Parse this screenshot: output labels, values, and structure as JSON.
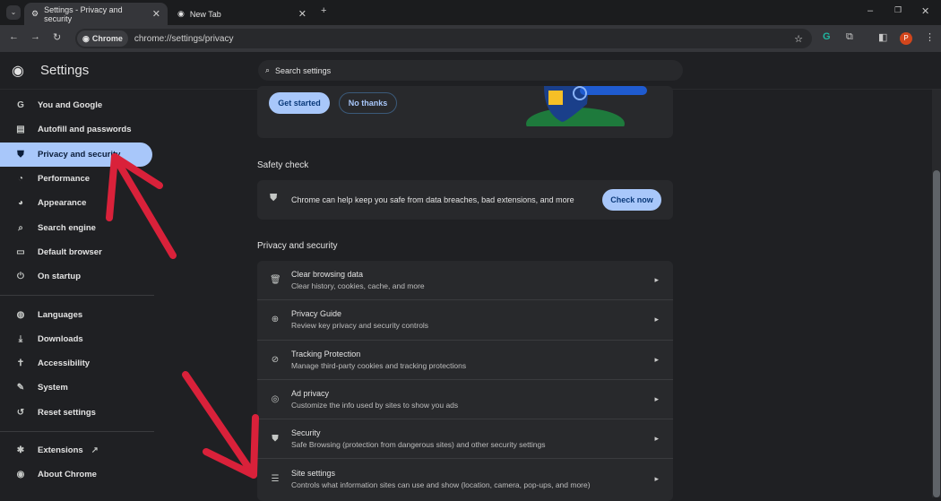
{
  "tabs": [
    {
      "label": "Settings - Privacy and security",
      "icon": "gear-icon"
    },
    {
      "label": "New Tab",
      "icon": "chrome-icon"
    }
  ],
  "omnibox": {
    "chip": "Chrome",
    "url": "chrome://settings/privacy"
  },
  "header": {
    "title": "Settings",
    "search_placeholder": "Search settings"
  },
  "profile_initial": "P",
  "sidebar": {
    "items": [
      {
        "label": "You and Google",
        "icon": "G"
      },
      {
        "label": "Autofill and passwords",
        "icon": "▤"
      },
      {
        "label": "Privacy and security",
        "icon": "⛊",
        "selected": true
      },
      {
        "label": "Performance",
        "icon": "◔"
      },
      {
        "label": "Appearance",
        "icon": "◕"
      },
      {
        "label": "Search engine",
        "icon": "⌕"
      },
      {
        "label": "Default browser",
        "icon": "▭"
      },
      {
        "label": "On startup",
        "icon": "⏻"
      },
      {
        "label": "Languages",
        "icon": "◍"
      },
      {
        "label": "Downloads",
        "icon": "⤓"
      },
      {
        "label": "Accessibility",
        "icon": "✝"
      },
      {
        "label": "System",
        "icon": "✎"
      },
      {
        "label": "Reset settings",
        "icon": "↺"
      },
      {
        "label": "Extensions",
        "icon": "✱"
      },
      {
        "label": "About Chrome",
        "icon": "◉"
      }
    ]
  },
  "promo": {
    "get_started": "Get started",
    "no_thanks": "No thanks"
  },
  "safety_check": {
    "heading": "Safety check",
    "text": "Chrome can help keep you safe from data breaches, bad extensions, and more",
    "button": "Check now"
  },
  "privacy": {
    "heading": "Privacy and security",
    "rows": [
      {
        "title": "Clear browsing data",
        "subtitle": "Clear history, cookies, cache, and more",
        "icon": "🗑"
      },
      {
        "title": "Privacy Guide",
        "subtitle": "Review key privacy and security controls",
        "icon": "⊕"
      },
      {
        "title": "Tracking Protection",
        "subtitle": "Manage third-party cookies and tracking protections",
        "icon": "⊘"
      },
      {
        "title": "Ad privacy",
        "subtitle": "Customize the info used by sites to show you ads",
        "icon": "◎"
      },
      {
        "title": "Security",
        "subtitle": "Safe Browsing (protection from dangerous sites) and other security settings",
        "icon": "⛊"
      },
      {
        "title": "Site settings",
        "subtitle": "Controls what information sites can use and show (location, camera, pop-ups, and more)",
        "icon": "☰"
      }
    ]
  },
  "colors": {
    "accent": "#a8c7fa",
    "annotation_arrow": "#d9213a"
  }
}
